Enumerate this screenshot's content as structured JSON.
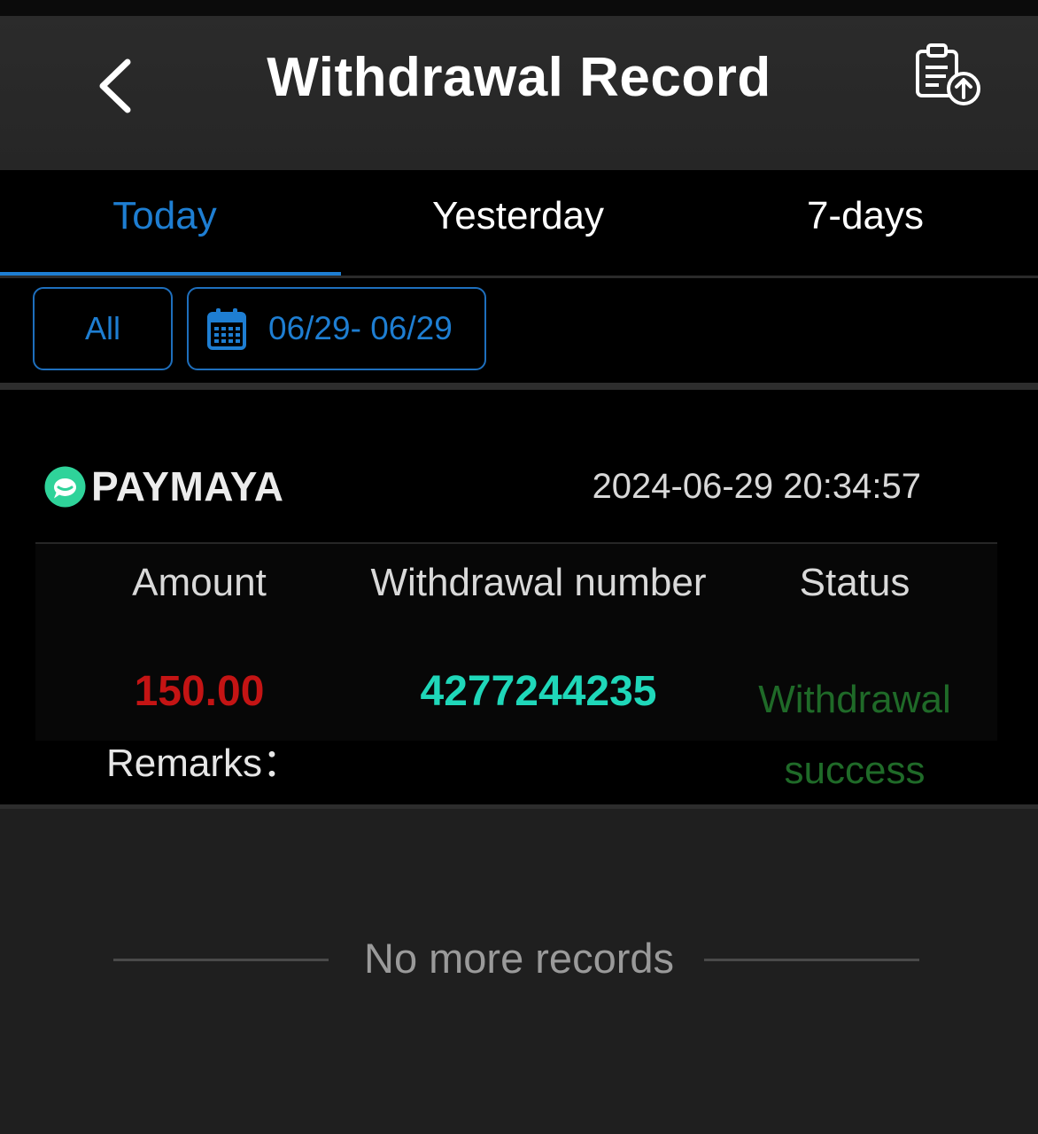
{
  "header": {
    "title": "Withdrawal Record",
    "back_icon": "chevron-left-icon",
    "export_icon": "clipboard-upload-icon"
  },
  "tabs": [
    {
      "label": "Today",
      "active": true
    },
    {
      "label": "Yesterday",
      "active": false
    },
    {
      "label": "7-days",
      "active": false
    }
  ],
  "filters": {
    "type_label": "All",
    "date_range": "06/29- 06/29",
    "date_icon": "calendar-icon"
  },
  "record": {
    "method": "PAYMAYA",
    "method_icon": "paymaya-logo-icon",
    "datetime": "2024-06-29 20:34:57",
    "columns": {
      "amount": "Amount",
      "withdrawal_number": "Withdrawal number",
      "status": "Status"
    },
    "amount": "150.00",
    "withdrawal_number": "4277244235",
    "status_line1": "Withdrawal",
    "status_line2": "success",
    "remarks_label": "Remarks："
  },
  "footer": {
    "no_more": "No more records"
  },
  "colors": {
    "accent": "#1e7ed2",
    "amount": "#c41414",
    "withdrawal_number": "#1fd7b9",
    "status_success": "#1f6a28"
  }
}
